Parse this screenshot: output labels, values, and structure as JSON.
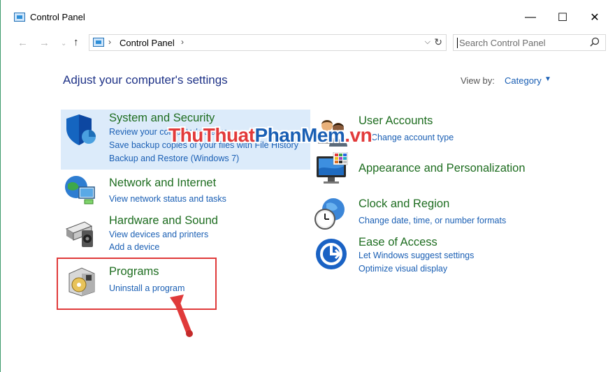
{
  "window": {
    "title": "Control Panel",
    "minimize": "—",
    "maximize": "☐",
    "close": "✕"
  },
  "nav": {
    "back": "←",
    "forward": "→",
    "recent": "⌄",
    "up": "↑"
  },
  "address": {
    "sep": "›",
    "path": "Control Panel",
    "dropdown": "⌵",
    "refresh": "↻"
  },
  "search": {
    "placeholder": "Search Control Panel",
    "icon": "⚲"
  },
  "page": {
    "heading": "Adjust your computer's settings",
    "view_by_label": "View by:",
    "view_by_value": "Category",
    "view_by_caret": "▼"
  },
  "categories": [
    {
      "title": "System and Security",
      "links": [
        "Review your computer's status",
        "Save backup copies of your files with File History",
        "Backup and Restore (Windows 7)"
      ]
    },
    {
      "title": "Network and Internet",
      "links": [
        "View network status and tasks"
      ]
    },
    {
      "title": "Hardware and Sound",
      "links": [
        "View devices and printers",
        "Add a device"
      ]
    },
    {
      "title": "Programs",
      "links": [
        "Uninstall a program"
      ]
    },
    {
      "title": "User Accounts",
      "links": [
        "Change account type"
      ]
    },
    {
      "title": "Appearance and Personalization",
      "links": []
    },
    {
      "title": "Clock and Region",
      "links": [
        "Change date, time, or number formats"
      ]
    },
    {
      "title": "Ease of Access",
      "links": [
        "Let Windows suggest settings",
        "Optimize visual display"
      ]
    }
  ],
  "watermark": {
    "part1": "ThuThuat",
    "part2": "PhanMem",
    "part3": ".vn"
  },
  "colors": {
    "title_green": "#1e6d20",
    "link_blue": "#1a5fb4",
    "heading_blue": "#1e3287",
    "highlight": "#dcebfa",
    "annotation_red": "#e03a3a"
  }
}
